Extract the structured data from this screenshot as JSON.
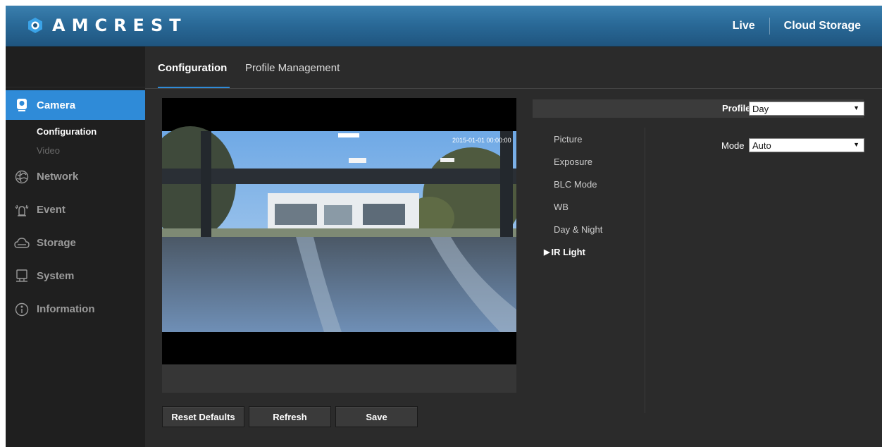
{
  "header": {
    "brand": "AMCREST",
    "nav": [
      {
        "label": "Live"
      },
      {
        "label": "Cloud Storage"
      }
    ]
  },
  "sidebar": {
    "items": [
      {
        "label": "Camera",
        "icon": "camera-icon",
        "active": true,
        "children": [
          {
            "label": "Configuration",
            "selected": true
          },
          {
            "label": "Video",
            "selected": false
          }
        ]
      },
      {
        "label": "Network",
        "icon": "network-icon"
      },
      {
        "label": "Event",
        "icon": "event-alarm-icon"
      },
      {
        "label": "Storage",
        "icon": "storage-cloud-icon"
      },
      {
        "label": "System",
        "icon": "system-monitor-icon"
      },
      {
        "label": "Information",
        "icon": "info-icon"
      }
    ]
  },
  "tabs": [
    {
      "label": "Configuration",
      "active": true
    },
    {
      "label": "Profile Management",
      "active": false
    }
  ],
  "video": {
    "overlay_text": "2015-01-01 00:00:00"
  },
  "buttons": {
    "reset": "Reset Defaults",
    "refresh": "Refresh",
    "save": "Save"
  },
  "settings": {
    "profile_label": "Profile",
    "profile_value": "Day",
    "mode_label": "Mode",
    "mode_value": "Auto",
    "items": [
      {
        "label": "Picture"
      },
      {
        "label": "Exposure"
      },
      {
        "label": "BLC Mode"
      },
      {
        "label": "WB"
      },
      {
        "label": "Day & Night"
      },
      {
        "label": "IR Light",
        "selected": true
      }
    ]
  },
  "colors": {
    "accent": "#2f8bd8",
    "header_blue": "#2a6a98",
    "background": "#2b2b2b",
    "sidebar": "#1f1f1f"
  }
}
